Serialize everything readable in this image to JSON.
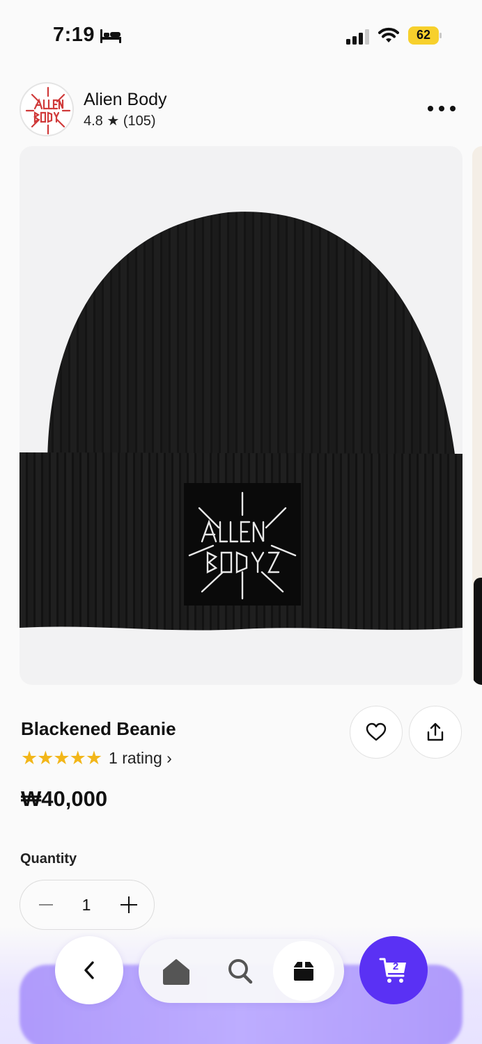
{
  "status_bar": {
    "time": "7:19",
    "battery": "62",
    "icons": [
      "bed-icon",
      "cellular-signal-icon",
      "wifi-icon",
      "battery-icon"
    ]
  },
  "shop": {
    "name": "Alien Body",
    "rating": "4.8 ★ (105)",
    "logo_icon": "alien-body-logo"
  },
  "product": {
    "title": "Blackened Beanie",
    "stars": "★★★★★",
    "rating_link": "1 rating ›",
    "price": "₩40,000",
    "image_icon": "black-ribbed-beanie-photo"
  },
  "quantity": {
    "label": "Quantity",
    "value": "1"
  },
  "bottom_nav": {
    "cart_count": "2",
    "icons": [
      "back-chevron-icon",
      "home-icon",
      "search-icon",
      "orders-icon",
      "cart-icon"
    ]
  },
  "colors": {
    "accent": "#5a31f4",
    "star": "#f2b619",
    "battery": "#f7d02c",
    "logo_red": "#d03a3a"
  }
}
